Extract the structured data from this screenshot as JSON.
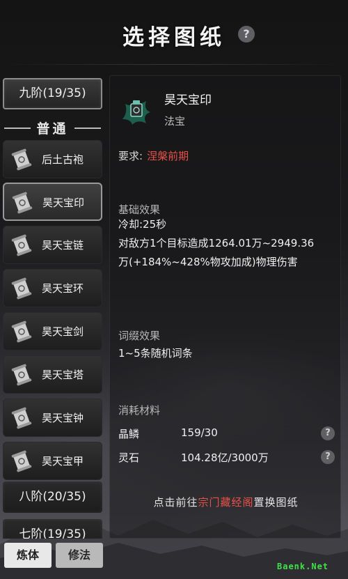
{
  "header": {
    "title": "选择图纸",
    "help_symbol": "?"
  },
  "sidebar": {
    "tiers": [
      {
        "label": "九阶(19/35)"
      },
      {
        "label": "八阶(20/35)"
      },
      {
        "label": "七阶(19/35)"
      }
    ],
    "category_label": "普通",
    "items": [
      {
        "label": "后土古袍",
        "icon": "scroll-icon"
      },
      {
        "label": "昊天宝印",
        "icon": "scroll-icon",
        "selected": true
      },
      {
        "label": "昊天宝链",
        "icon": "scroll-icon"
      },
      {
        "label": "昊天宝环",
        "icon": "scroll-icon"
      },
      {
        "label": "昊天宝剑",
        "icon": "scroll-icon"
      },
      {
        "label": "昊天宝塔",
        "icon": "scroll-icon"
      },
      {
        "label": "昊天宝钟",
        "icon": "scroll-icon"
      },
      {
        "label": "昊天宝甲",
        "icon": "scroll-icon"
      }
    ]
  },
  "tabs": [
    {
      "label": "炼体",
      "active": true
    },
    {
      "label": "修法",
      "active": false
    }
  ],
  "detail": {
    "name": "昊天宝印",
    "type": "法宝",
    "requirement_label": "要求:",
    "requirement_value": "涅槃前期",
    "base_effect_title": "基础效果",
    "cooldown": "冷却:25秒",
    "effect_line1": "对敌方1个目标造成1264.01万~2949.36",
    "effect_line2": "万(+184%~428%物攻加成)物理伤害",
    "affix_title": "词缀效果",
    "affix_text": "1~5条随机词条",
    "materials_title": "消耗材料",
    "materials": [
      {
        "name": "晶鳞",
        "qty": "159/30"
      },
      {
        "name": "灵石",
        "qty": "104.28亿/3000万"
      }
    ],
    "footer_prefix": "点击前往",
    "footer_link": "宗门藏经阁",
    "footer_suffix": "置换图纸"
  },
  "colors": {
    "accent_red": "#e8504a",
    "watermark_green": "#3fe04a"
  },
  "watermark": "Baenk.Net"
}
